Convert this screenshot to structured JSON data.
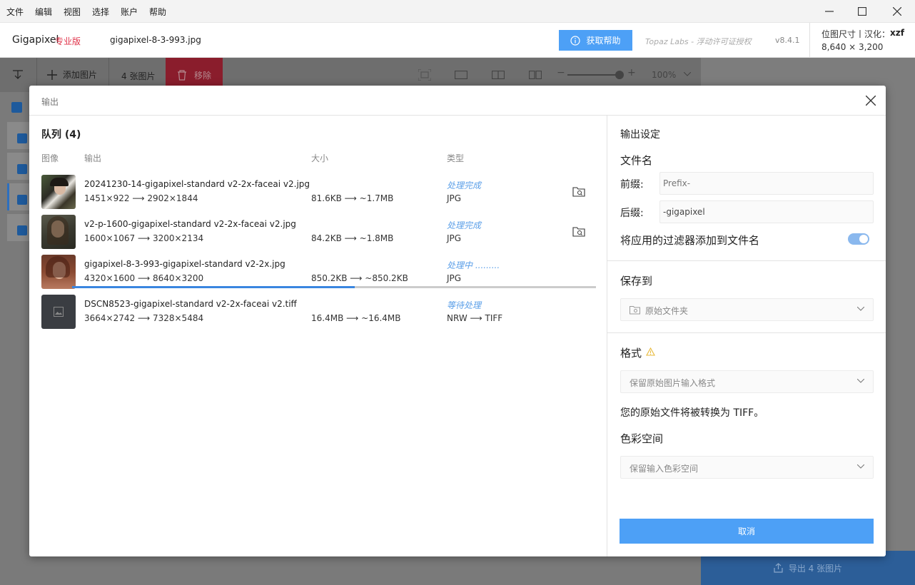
{
  "menu": {
    "items": [
      "文件",
      "编辑",
      "视图",
      "选择",
      "账户",
      "帮助"
    ]
  },
  "window_controls": {
    "minimize": "—",
    "maximize": "☐",
    "close": "✕"
  },
  "header": {
    "app_name": "Gigapixel",
    "edition": "专业版",
    "filename": "gigapixel-8-3-993.jpg",
    "help_button": "获取帮助",
    "license": "Topaz Labs - 浮动许可证授权",
    "version": "v8.4.1",
    "dims_label": "位图尺寸丨汉化：",
    "translator": "xzf",
    "dims_value": "8,640 × 3,200"
  },
  "toolbar": {
    "add_images": "添加图片",
    "count": "4 张图片",
    "remove": "移除",
    "zoom": "100%"
  },
  "dialog": {
    "title": "输出",
    "queue_title": "队列 (4)",
    "columns": {
      "image": "图像",
      "output": "输出",
      "size": "大小",
      "type": "类型"
    },
    "rows": [
      {
        "name": "20241230-14-gigapixel-standard v2-2x-faceai v2.jpg",
        "dims": "1451×922 ⟶ 2902×1844",
        "size": "81.6KB ⟶ ~1.7MB",
        "status": "处理完成",
        "type": "JPG"
      },
      {
        "name": "v2-p-1600-gigapixel-standard v2-2x-faceai v2.jpg",
        "dims": "1600×1067 ⟶ 3200×2134",
        "size": "84.2KB ⟶ ~1.8MB",
        "status": "处理完成",
        "type": "JPG"
      },
      {
        "name": "gigapixel-8-3-993-gigapixel-standard v2-2x.jpg",
        "dims": "4320×1600 ⟶ 8640×3200",
        "size": "850.2KB ⟶ ~850.2KB",
        "status": "处理中 .........",
        "type": "JPG"
      },
      {
        "name": "DSCN8523-gigapixel-standard v2-2x-faceai v2.tiff",
        "dims": "3664×2742 ⟶ 7328×5484",
        "size": "16.4MB ⟶ ~16.4MB",
        "status": "等待处理",
        "type": "NRW ⟶ TIFF"
      }
    ],
    "progress": 0.54,
    "settings": {
      "title": "输出设定",
      "filename_title": "文件名",
      "prefix_label": "前缀:",
      "prefix_placeholder": "Prefix-",
      "suffix_label": "后缀:",
      "suffix_value": "-gigapixel",
      "filter_toggle_label": "将应用的过滤器添加到文件名",
      "save_to_title": "保存到",
      "save_to_value": "原始文件夹",
      "format_title": "格式",
      "format_value": "保留原始图片输入格式",
      "convert_note": "您的原始文件将被转换为 TIFF。",
      "color_space_title": "色彩空间",
      "color_space_value": "保留输入色彩空间",
      "cancel": "取消"
    }
  },
  "export_button": "导出 4 张图片",
  "colors": {
    "accent": "#4da0f6",
    "brand_red": "#e0344a",
    "status": "#5b9fe8"
  }
}
